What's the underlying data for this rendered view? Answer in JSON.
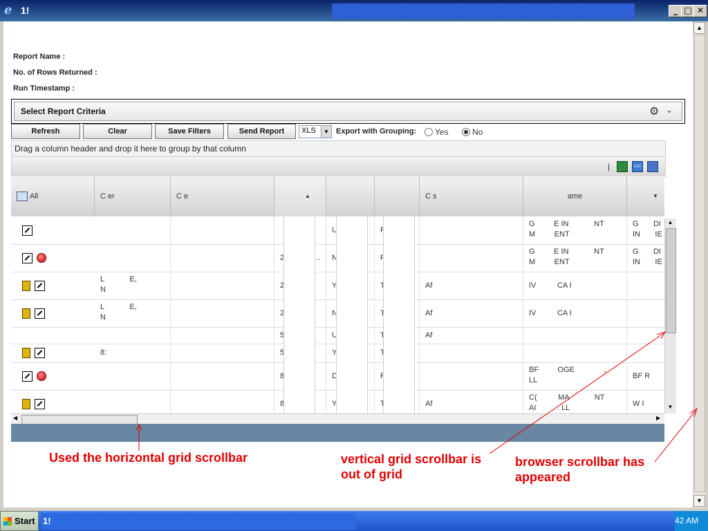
{
  "window": {
    "title": "1!",
    "icon": "ie-icon",
    "minimize": "_",
    "maximize": "□",
    "close": "✕"
  },
  "report_info": {
    "name_label": "Report Name :",
    "rows_label": "No. of Rows Returned :",
    "timestamp_label": "Run Timestamp :"
  },
  "criteria": {
    "title": "Select Report Criteria"
  },
  "toolbar": {
    "refresh": "Refresh",
    "clear": "Clear",
    "save_filters": "Save Filters",
    "send_report": "Send Report",
    "format_value": "XLS",
    "export_grouping_label": "Export with Grouping:",
    "yes_label": "Yes",
    "no_label": "No",
    "selected": "No"
  },
  "grid": {
    "group_hint": "Drag a column header and drop it here to group by that column",
    "toolbar_sep": "|",
    "headers": [
      "All",
      "C                er",
      "C                e",
      "",
      "",
      "",
      "C                s",
      "ame",
      ""
    ],
    "rows": [
      {
        "icons": [
          "edit"
        ],
        "c1": "",
        "c2": "",
        "c3": "",
        "c4": "U        I",
        "c5": "P",
        "c6": "",
        "c7": "G         E IN            NT\nM         ENT",
        "c8": "G       DI\nIN       IE"
      },
      {
        "icons": [
          "edit",
          "delete"
        ],
        "c1": "",
        "c2": "",
        "c3": "2            0...",
        "c4": "N",
        "c5": "P",
        "c6": "",
        "c7": "G         E IN            NT\nM         ENT",
        "c8": "G       DI\nIN       IE"
      },
      {
        "icons": [
          "note",
          "edit"
        ],
        "c1": "L            E,\nN",
        "c2": "",
        "c3": "2",
        "c4": "Y",
        "c5": "T",
        "c6": "Af",
        "c7": "IV          CA I",
        "c8": ""
      },
      {
        "icons": [
          "note",
          "edit"
        ],
        "c1": "L            E,\nN",
        "c2": "",
        "c3": "2",
        "c4": "N",
        "c5": "T",
        "c6": "Af",
        "c7": "IV          CA I",
        "c8": ""
      },
      {
        "icons": [],
        "c1": "",
        "c2": "",
        "c3": "5",
        "c4": "U        I",
        "c5": "T",
        "c6": "Af",
        "c7": "",
        "c8": ""
      },
      {
        "icons": [
          "note",
          "edit"
        ],
        "c1": "8:",
        "c2": "",
        "c3": "5",
        "c4": "Y",
        "c5": "T",
        "c6": "",
        "c7": "",
        "c8": ""
      },
      {
        "icons": [
          "edit",
          "delete"
        ],
        "c1": "",
        "c2": "",
        "c3": "8",
        "c4": "D",
        "c5": "P",
        "c6": "",
        "c7": "BF         OGE              ,\nLL",
        "c8": "BF          R"
      },
      {
        "icons": [
          "note",
          "edit"
        ],
        "c1": "",
        "c2": "",
        "c3": "8",
        "c4": "Y",
        "c5": "T",
        "c6": "Af",
        "c7": "C(          MA            NT\nAI          . LL",
        "c8": "W         I"
      }
    ]
  },
  "annotations": {
    "hscroll_note": "Used the horizontal grid scrollbar",
    "vscroll_note_1": "vertical grid scrollbar is",
    "vscroll_note_2": "out of grid",
    "browser_note_1": "browser scrollbar has",
    "browser_note_2": "appeared"
  },
  "colors": {
    "annotation": "#e00000",
    "footer_bar": "#6986a3",
    "taskbar": "#2d6ae0"
  },
  "taskbar": {
    "start": "Start",
    "task": "1!",
    "clock": "42 AM"
  }
}
